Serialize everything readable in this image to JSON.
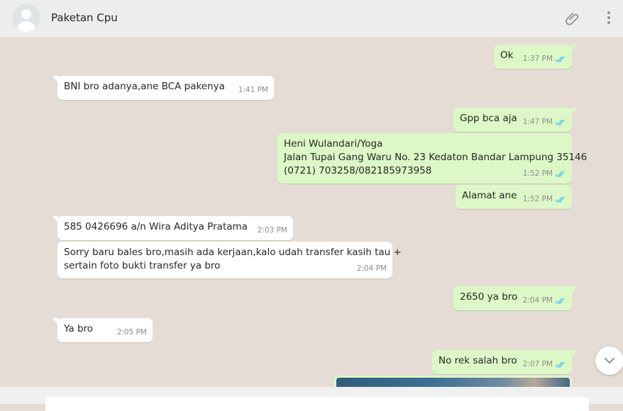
{
  "header": {
    "title": "Paketan Cpu"
  },
  "messages": [
    {
      "dir": "out",
      "text": "Ok",
      "time": "1:37 PM"
    },
    {
      "dir": "in",
      "text": "BNI bro adanya,ane BCA pakenya",
      "time": "1:41 PM"
    },
    {
      "dir": "out",
      "text": "Gpp bca aja",
      "time": "1:47 PM"
    },
    {
      "dir": "out",
      "lines": [
        "Heni Wulandari/Yoga",
        "Jalan Tupai Gang Waru No. 23 Kedaton Bandar Lampung 35146",
        "(0721) 703258/082185973958"
      ],
      "time": "1:52 PM"
    },
    {
      "dir": "out",
      "text": "Alamat ane",
      "time": "1:52 PM"
    },
    {
      "dir": "in",
      "text": "585 0426696 a/n Wira Aditya Pratama",
      "time": "2:03 PM"
    },
    {
      "dir": "in",
      "lines": [
        "Sorry baru bales bro,masih ada kerjaan,kalo udah transfer kasih tau +",
        "sertain foto bukti transfer ya bro"
      ],
      "time": "2:04 PM"
    },
    {
      "dir": "out",
      "text": "2650 ya bro",
      "time": "2:04 PM"
    },
    {
      "dir": "in",
      "text": "Ya bro",
      "time": "2:05 PM"
    },
    {
      "dir": "out",
      "text": "No rek salah bro",
      "time": "2:07 PM"
    }
  ],
  "icons": {
    "attach": "paperclip-icon",
    "menu": "vertical-dots-icon",
    "scroll": "chevron-down-icon",
    "ticks": "double-check-icon"
  },
  "colors": {
    "incoming": "#ffffff",
    "outgoing": "#dcf8c6",
    "ticks": "#4fc3f7",
    "background": "#e5ddd5"
  }
}
